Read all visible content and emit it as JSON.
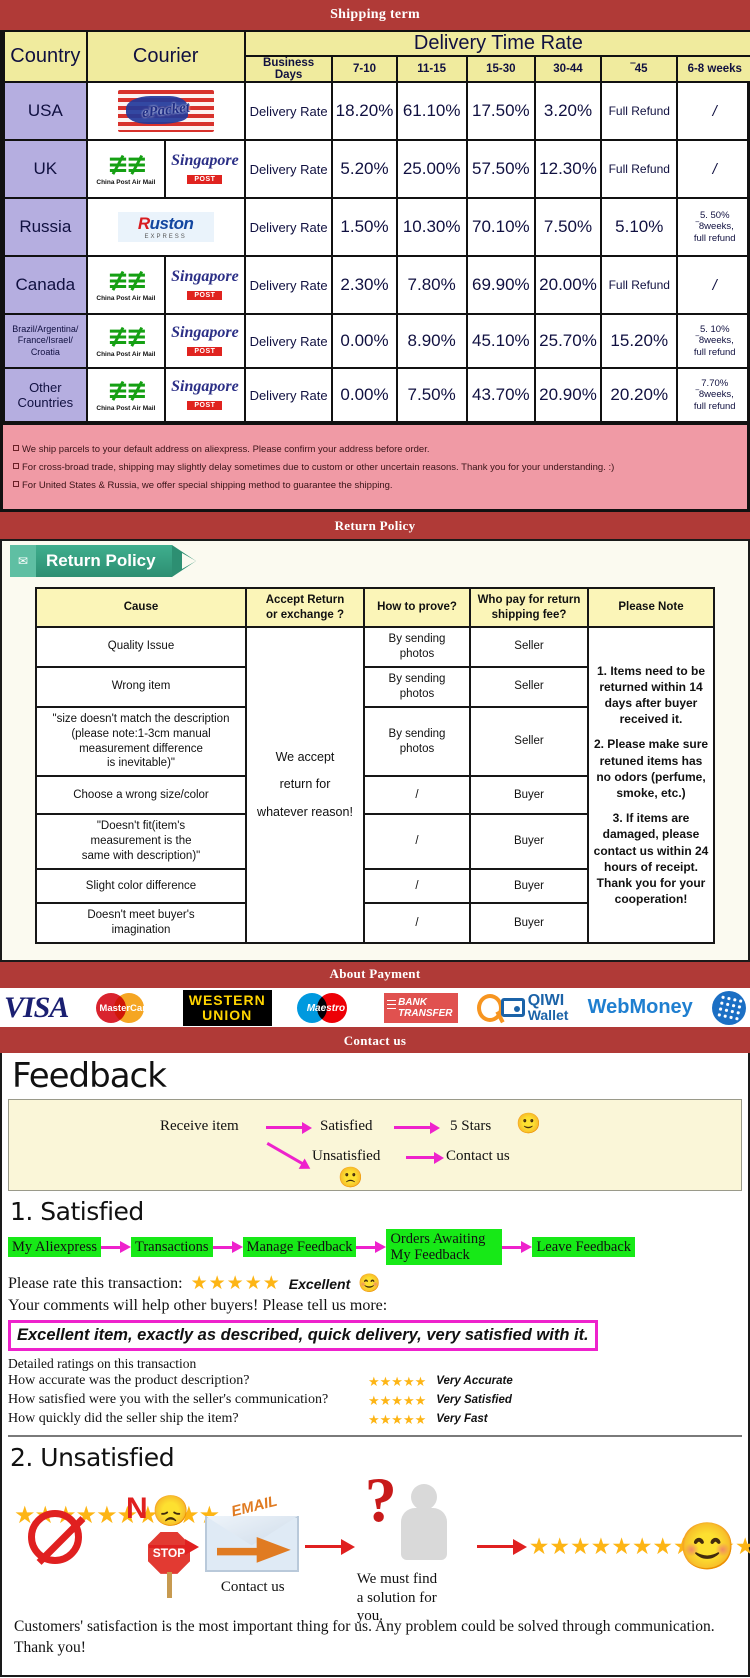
{
  "banners": {
    "shipping": "Shipping term",
    "return": "Return Policy",
    "payment": "About Payment",
    "contact": "Contact us"
  },
  "shipping_table": {
    "headers": {
      "country": "Country",
      "courier": "Courier",
      "delivery_time_rate": "Delivery Time Rate",
      "business_days": "Business Days",
      "ranges": [
        "7-10",
        "11-15",
        "15-30",
        "30-44",
        "‾45",
        "6-8 weeks"
      ]
    },
    "rows": [
      {
        "country": "USA",
        "couriers": [
          "epacket-logo"
        ],
        "label": "Delivery Rate",
        "values": [
          "18.20%",
          "61.10%",
          "17.50%",
          "3.20%",
          "Full Refund",
          "/"
        ]
      },
      {
        "country": "UK",
        "couriers": [
          "china-post-air-mail-logo",
          "singapore-post-logo"
        ],
        "label": "Delivery Rate",
        "values": [
          "5.20%",
          "25.00%",
          "57.50%",
          "12.30%",
          "Full Refund",
          "/"
        ]
      },
      {
        "country": "Russia",
        "couriers": [
          "ruston-express-logo"
        ],
        "label": "Delivery Rate",
        "values": [
          "1.50%",
          "10.30%",
          "70.10%",
          "7.50%",
          "5.10%",
          "5. 50%\n‾8weeks,\nfull refund"
        ]
      },
      {
        "country": "Canada",
        "couriers": [
          "china-post-air-mail-logo",
          "singapore-post-logo"
        ],
        "label": "Delivery Rate",
        "values": [
          "2.30%",
          "7.80%",
          "69.90%",
          "20.00%",
          "Full Refund",
          "/"
        ]
      },
      {
        "country": "Brazil/Argentina/\nFrance/Israel/\nCroatia",
        "couriers": [
          "china-post-air-mail-logo",
          "singapore-post-logo"
        ],
        "label": "Delivery Rate",
        "values": [
          "0.00%",
          "8.90%",
          "45.10%",
          "25.70%",
          "15.20%",
          "5. 10%\n‾8weeks,\nfull refund"
        ]
      },
      {
        "country": "Other Countries",
        "couriers": [
          "china-post-air-mail-logo",
          "singapore-post-logo"
        ],
        "label": "Delivery Rate",
        "values": [
          "0.00%",
          "7.50%",
          "43.70%",
          "20.90%",
          "20.20%",
          "7.70%\n‾8weeks,\nfull refund"
        ]
      }
    ],
    "notes": [
      "We ship parcels to your default address on aliexpress. Please confirm your address before order.",
      "For cross-broad trade, shipping may slightly delay sometimes due to custom or other uncertain reasons. Thank you for your understanding. :)",
      "For United States & Russia, we offer special shipping method to guarantee the shipping."
    ]
  },
  "return_policy": {
    "ribbon_label": "Return Policy",
    "headers": [
      "Cause",
      "Accept Return\nor exchange ?",
      "How to prove?",
      "Who pay for return\nshipping fee?",
      "Please Note"
    ],
    "accept_text": "We accept\nreturn for\nwhatever reason!",
    "rows": [
      {
        "cause": "Quality Issue",
        "prove": "By sending\nphotos",
        "payer": "Seller"
      },
      {
        "cause": "Wrong item",
        "prove": "By sending\nphotos",
        "payer": "Seller"
      },
      {
        "cause": "\"size doesn't match the description\n(please note:1-3cm manual\nmeasurement difference\nis inevitable)\"",
        "prove": "By sending\nphotos",
        "payer": "Seller"
      },
      {
        "cause": "Choose a wrong size/color",
        "prove": "/",
        "payer": "Buyer"
      },
      {
        "cause": "\"Doesn't fit(item's\nmeasurement is the\nsame with description)\"",
        "prove": "/",
        "payer": "Buyer"
      },
      {
        "cause": "Slight color difference",
        "prove": "/",
        "payer": "Buyer"
      },
      {
        "cause": "Doesn't meet buyer's\nimagination",
        "prove": "/",
        "payer": "Buyer"
      }
    ],
    "notes": [
      "1. Items need to be returned within 14 days after buyer received it.",
      "2. Please make sure retuned items has no odors (perfume, smoke, etc.)",
      "3. If items are damaged, please contact us within 24 hours of receipt.\nThank you for your cooperation!"
    ]
  },
  "payment_methods": [
    {
      "name": "visa-logo",
      "label": "VISA"
    },
    {
      "name": "mastercard-logo",
      "label": "MasterCard"
    },
    {
      "name": "western-union-logo",
      "label1": "WESTERN",
      "label2": "UNION"
    },
    {
      "name": "maestro-logo",
      "label": "Maestro"
    },
    {
      "name": "bank-transfer-logo",
      "label1": "BANK",
      "label2": "TRANSFER"
    },
    {
      "name": "qiwi-wallet-logo",
      "label1": "QIWI",
      "label2": "Wallet"
    },
    {
      "name": "webmoney-logo",
      "label": "WebMoney"
    }
  ],
  "feedback": {
    "title": "Feedback",
    "flow": {
      "receive": "Receive item",
      "satisfied": "Satisfied",
      "five_stars": "5 Stars",
      "unsatisfied": "Unsatisfied",
      "contact": "Contact us",
      "happy_emoji": "🙂",
      "sad_emoji": "🙁"
    },
    "satisfied": {
      "heading": "1. Satisfied",
      "steps": [
        "My Aliexpress",
        "Transactions",
        "Manage Feedback",
        "Orders Awaiting\nMy Feedback",
        "Leave Feedback"
      ],
      "rate_prompt": "Please rate this transaction:",
      "rate_stars": "★★★★★",
      "rate_word": "Excellent",
      "rate_emoji": "😊",
      "comments_prompt": "Your comments will help other buyers! Please tell us more:",
      "comment_text": "Excellent item, exactly as described, quick delivery, very satisfied with it.",
      "detailed_heading": "Detailed ratings on this transaction",
      "detailed": [
        {
          "question": "How accurate was the product description?",
          "stars": "★★★★★",
          "label": "Very Accurate"
        },
        {
          "question": "How satisfied were you with the seller's communication?",
          "stars": "★★★★★",
          "label": "Very Satisfied"
        },
        {
          "question": "How quickly did the seller ship the item?",
          "stars": "★★★★★",
          "label": "Very Fast"
        }
      ]
    },
    "unsatisfied": {
      "heading": "2. Unsatisfied",
      "no_label": "N",
      "stop_label": "STOP",
      "email_label": "EMAIL",
      "contact_caption": "Contact us",
      "solution_caption": "We must find\na solution for\nyou.",
      "good_stars": "★★★★★★★★★★★★★★★",
      "bad_stars": "★★★★★★★★★★",
      "smile_emoji": "😊",
      "sad_emoji": "😞",
      "closing": "Customers' satisfaction is the most important thing for us. Any problem could be solved through communication. Thank you!"
    }
  }
}
